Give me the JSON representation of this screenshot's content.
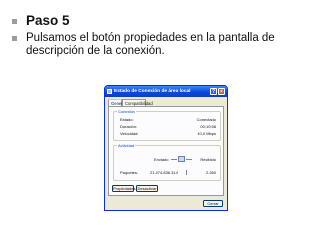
{
  "slide": {
    "bullets": [
      {
        "text": "Paso 5"
      },
      {
        "text": "Pulsamos el botón propiedades en la pantalla de descripción de la conexión."
      }
    ]
  },
  "dialog": {
    "title": "Estado de Conexión de área local",
    "help_glyph": "?",
    "close_glyph": "×",
    "tabs": [
      "General",
      "Compatibilidad"
    ],
    "connection": {
      "legend": "Conexión",
      "rows": [
        {
          "label": "Estado:",
          "value": "Conectado"
        },
        {
          "label": "Duración:",
          "value": "00:10:58"
        },
        {
          "label": "Velocidad:",
          "value": "10,0 Mbps"
        }
      ]
    },
    "activity": {
      "legend": "Actividad",
      "sent_label": "Enviado",
      "received_label": "Recibido",
      "packets_label": "Paquetes:",
      "packets_sent": "21.474.836.314",
      "packets_received": "2.260"
    },
    "buttons": {
      "properties": "Propiedades",
      "disable": "Desactivar",
      "close": "Cerrar"
    }
  }
}
